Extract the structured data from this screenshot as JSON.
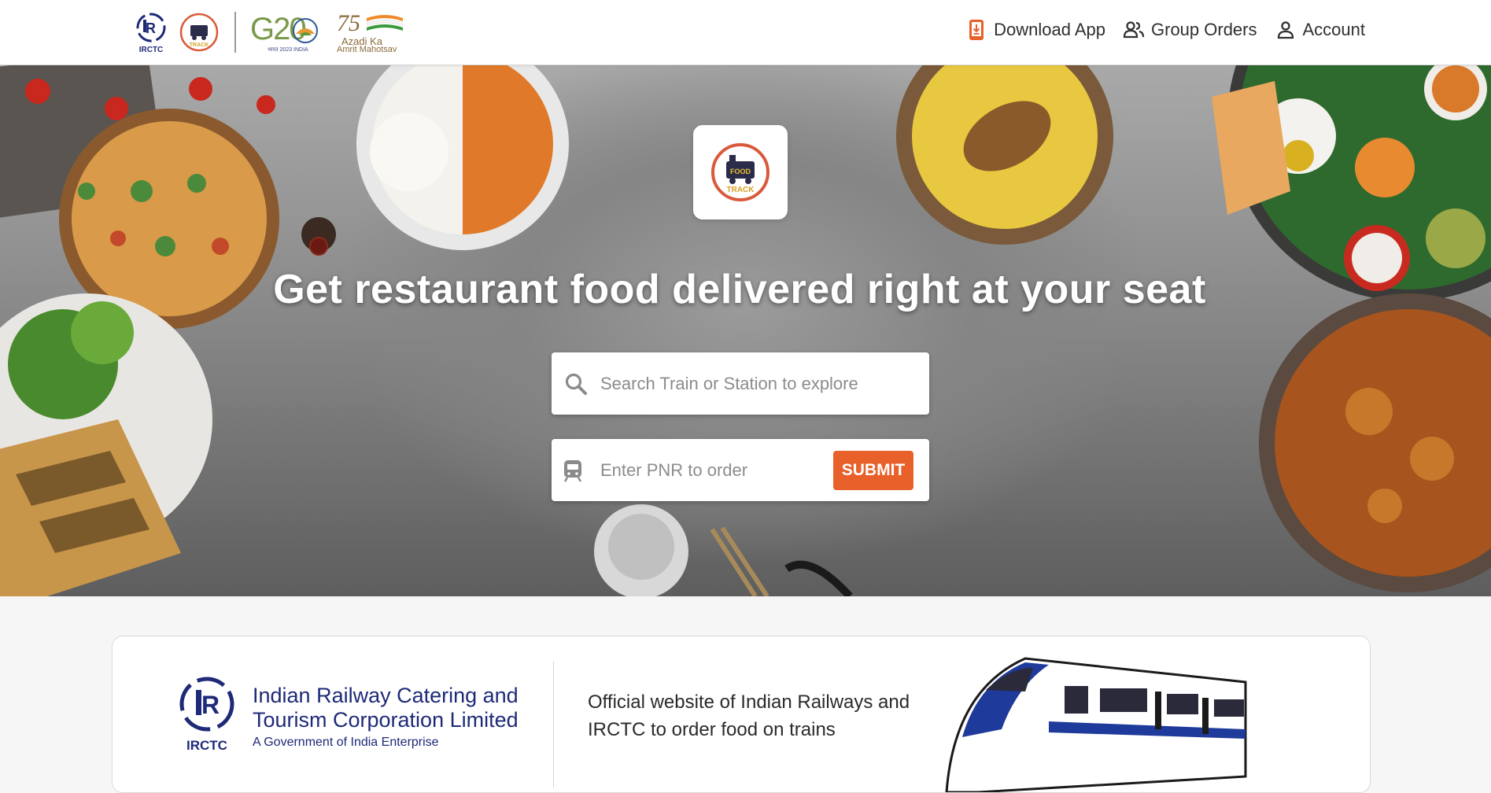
{
  "header": {
    "logos": {
      "irctc_caption": "IRCTC",
      "foodtrack_caption": "TRACK",
      "g20_text": "G20",
      "g20_sub": "भारत 2023 INDIA",
      "azadi_number": "75",
      "azadi_line1": "Azadi Ka",
      "azadi_line2": "Amrit Mahotsav"
    },
    "nav": {
      "download_app": "Download App",
      "group_orders": "Group Orders",
      "account": "Account"
    }
  },
  "hero": {
    "logo_text_top": "FOOD",
    "logo_text_bottom": "TRACK",
    "title": "Get restaurant food delivered right at your seat",
    "search_placeholder": "Search Train or Station to explore",
    "pnr_placeholder": "Enter PNR to order",
    "submit_label": "SUBMIT"
  },
  "info_card": {
    "org_name": "Indian Railway Catering and Tourism Corporation Limited",
    "org_sub": "A Government of India Enterprise",
    "emblem_caption": "IRCTC",
    "description": "Official website of Indian Railways and IRCTC to order food on trains"
  },
  "colors": {
    "accent": "#e8602a",
    "irctc_blue": "#1e2a78",
    "header_bg": "#ffffff"
  },
  "icons": {
    "download_app": "phone-download-icon",
    "group_orders": "group-users-icon",
    "account": "user-icon",
    "search": "search-icon",
    "pnr": "train-icon"
  }
}
